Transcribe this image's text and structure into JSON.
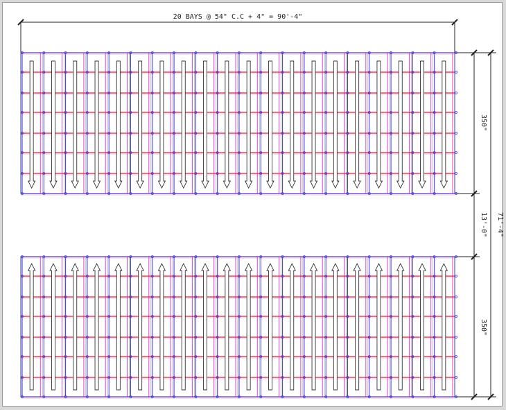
{
  "dimensions": {
    "top_width": "20 BAYS @ 54\" C.C + 4\" = 90'-4\"",
    "upper_block_depth": "350\"",
    "aisle_gap": "13'-0\"",
    "lower_block_depth": "350\"",
    "overall_depth": "71'-4\""
  },
  "layout": {
    "bays_per_block": 20,
    "blocks": [
      {
        "name": "upper-rack-block",
        "arrow_direction": "down"
      },
      {
        "name": "lower-rack-block",
        "arrow_direction": "up"
      }
    ]
  },
  "colors": {
    "beam_red": "#e02020",
    "upright_blue": "#3a3ad8",
    "upright_magenta": "#e040e0",
    "grid_line": "#bcbcbc",
    "dimension_line": "#222222",
    "arrow_outline": "#333333"
  }
}
